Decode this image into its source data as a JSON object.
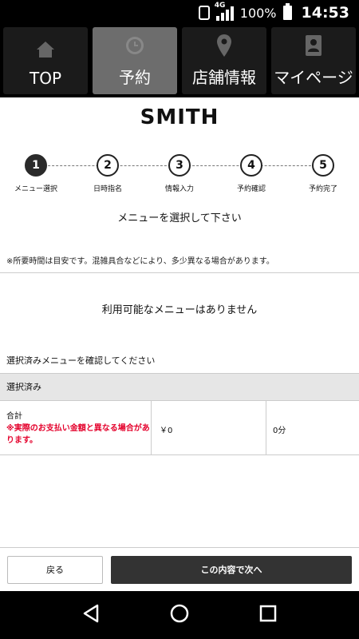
{
  "status_bar": {
    "network": "4G",
    "battery": "100%",
    "time": "14:53"
  },
  "nav": {
    "tabs": [
      {
        "label": "TOP",
        "icon": "home-icon"
      },
      {
        "label": "予約",
        "icon": "clock-icon",
        "active": true
      },
      {
        "label": "店舗情報",
        "icon": "map-pin-icon"
      },
      {
        "label": "マイページ",
        "icon": "person-card-icon"
      }
    ]
  },
  "brand": "SMITH",
  "steps": [
    {
      "num": "1",
      "label": "メニュー選択",
      "active": true
    },
    {
      "num": "2",
      "label": "日時指名"
    },
    {
      "num": "3",
      "label": "情報入力"
    },
    {
      "num": "4",
      "label": "予約確認"
    },
    {
      "num": "5",
      "label": "予約完了"
    }
  ],
  "instruction": "メニューを選択して下さい",
  "note": "※所要時間は目安です。混雑具合などにより、多少異なる場合があります。",
  "empty_message": "利用可能なメニューはありません",
  "confirm_label": "選択済みメニューを確認してください",
  "selected_header": "選択済み",
  "total": {
    "label": "合計",
    "warning": "※実際のお支払い金額と異なる場合があります。",
    "price": "￥0",
    "duration": "0分"
  },
  "buttons": {
    "back": "戻る",
    "next": "この内容で次へ"
  },
  "colors": {
    "accent_active_tab": "#6d6d6d",
    "warning": "#e4002b",
    "primary_button": "#333333"
  }
}
